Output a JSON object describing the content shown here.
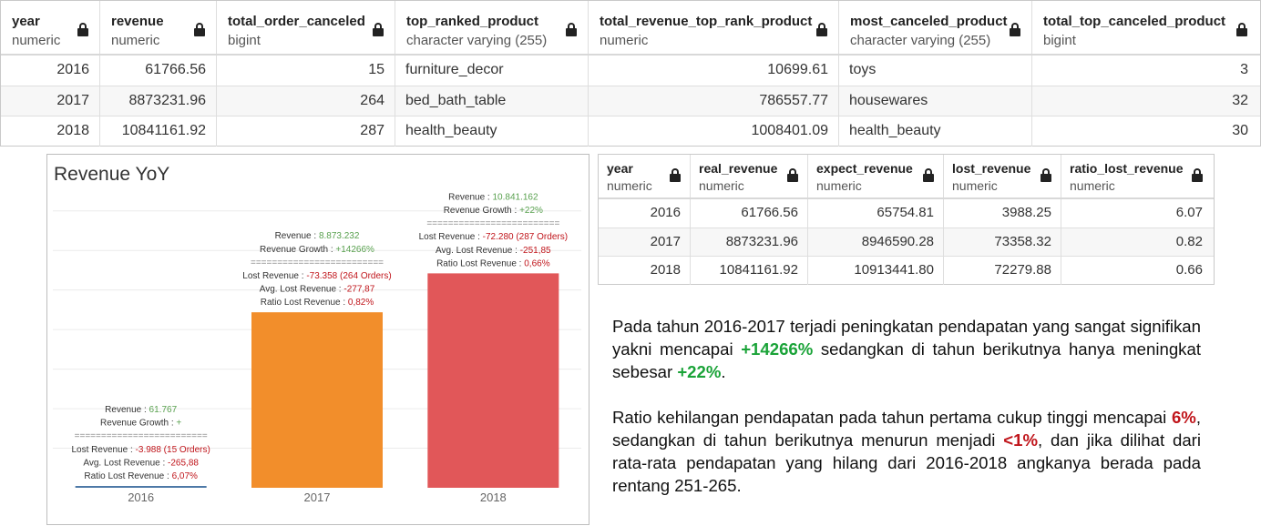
{
  "grid1": {
    "columns": [
      {
        "name": "year",
        "type": "numeric",
        "align": "num"
      },
      {
        "name": "revenue",
        "type": "numeric",
        "align": "num"
      },
      {
        "name": "total_order_canceled",
        "type": "bigint",
        "align": "num"
      },
      {
        "name": "top_ranked_product",
        "type": "character varying (255)",
        "align": "txt"
      },
      {
        "name": "total_revenue_top_rank_product",
        "type": "numeric",
        "align": "num"
      },
      {
        "name": "most_canceled_product",
        "type": "character varying (255)",
        "align": "txt"
      },
      {
        "name": "total_top_canceled_product",
        "type": "bigint",
        "align": "num"
      }
    ],
    "rows": [
      [
        "2016",
        "61766.56",
        "15",
        "furniture_decor",
        "10699.61",
        "toys",
        "3"
      ],
      [
        "2017",
        "8873231.96",
        "264",
        "bed_bath_table",
        "786557.77",
        "housewares",
        "32"
      ],
      [
        "2018",
        "10841161.92",
        "287",
        "health_beauty",
        "1008401.09",
        "health_beauty",
        "30"
      ]
    ]
  },
  "grid2": {
    "columns": [
      {
        "name": "year",
        "type": "numeric",
        "align": "num"
      },
      {
        "name": "real_revenue",
        "type": "numeric",
        "align": "num"
      },
      {
        "name": "expect_revenue",
        "type": "numeric",
        "align": "num"
      },
      {
        "name": "lost_revenue",
        "type": "numeric",
        "align": "num"
      },
      {
        "name": "ratio_lost_revenue",
        "type": "numeric",
        "align": "num"
      }
    ],
    "rows": [
      [
        "2016",
        "61766.56",
        "65754.81",
        "3988.25",
        "6.07"
      ],
      [
        "2017",
        "8873231.96",
        "8946590.28",
        "73358.32",
        "0.82"
      ],
      [
        "2018",
        "10841161.92",
        "10913441.80",
        "72279.88",
        "0.66"
      ]
    ]
  },
  "chart_data": {
    "type": "bar",
    "title": "Revenue YoY",
    "categories": [
      "2016",
      "2017",
      "2018"
    ],
    "values": [
      61767,
      8873232,
      10841162
    ],
    "colors": [
      "#4e79a7",
      "#f28e2b",
      "#e15759"
    ],
    "ylim": [
      0,
      15000000
    ],
    "grid": true,
    "annotations": [
      {
        "revenue_label": "Revenue : ",
        "revenue_value": "61.767",
        "growth_label": "Revenue Growth : ",
        "growth_value": "+",
        "separator": "=========================",
        "lost_label": "Lost Revenue : ",
        "lost_value": "-3.988 (15 Orders)",
        "avg_label": "Avg. Lost Revenue : ",
        "avg_value": "-265,88",
        "ratio_label": "Ratio Lost Revenue : ",
        "ratio_value": "6,07%"
      },
      {
        "revenue_label": "Revenue : ",
        "revenue_value": "8.873.232",
        "growth_label": "Revenue Growth : ",
        "growth_value": "+14266%",
        "separator": "=========================",
        "lost_label": "Lost Revenue : ",
        "lost_value": "-73.358 (264 Orders)",
        "avg_label": "Avg. Lost Revenue : ",
        "avg_value": "-277,87",
        "ratio_label": "Ratio Lost Revenue : ",
        "ratio_value": "0,82%"
      },
      {
        "revenue_label": "Revenue : ",
        "revenue_value": "10.841.162",
        "growth_label": "Revenue Growth : ",
        "growth_value": "+22%",
        "separator": "=========================",
        "lost_label": "Lost Revenue : ",
        "lost_value": "-72.280 (287 Orders)",
        "avg_label": "Avg. Lost Revenue : ",
        "avg_value": "-251,85",
        "ratio_label": "Ratio Lost Revenue : ",
        "ratio_value": "0,66%"
      }
    ],
    "label_colors": {
      "label": "#333333",
      "value_green": "#59a14f",
      "value_red": "#c0151b"
    }
  },
  "commentary": {
    "p1_a": "Pada tahun 2016-2017 terjadi peningkatan pendapatan yang sangat signifikan yakni mencapai ",
    "p1_b": "+14266%",
    "p1_c": " sedangkan di tahun berikutnya hanya meningkat sebesar ",
    "p1_d": "+22%",
    "p1_e": ".",
    "p2_a": "Ratio kehilangan pendapatan pada tahun pertama cukup tinggi mencapai ",
    "p2_b": "6%",
    "p2_c": ", sedangkan di tahun berikutnya menurun menjadi ",
    "p2_d": "<1%",
    "p2_e": ", dan jika dilihat dari rata-rata pendapatan yang hilang dari 2016-2018 angkanya berada pada rentang 251-265."
  },
  "colors": {
    "highlight_green": "#1aa338",
    "highlight_red": "#c0151b"
  }
}
